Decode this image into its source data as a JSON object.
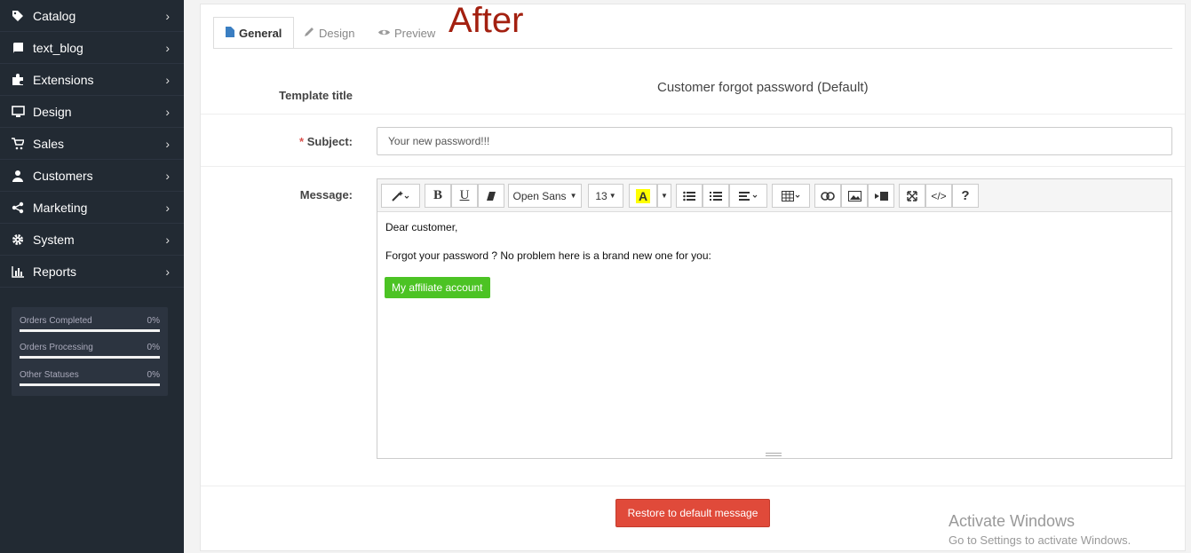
{
  "sidebar": {
    "items": [
      {
        "label": "Catalog",
        "icon": "tags-icon"
      },
      {
        "label": "text_blog",
        "icon": "book-icon"
      },
      {
        "label": "Extensions",
        "icon": "puzzle-icon"
      },
      {
        "label": "Design",
        "icon": "monitor-icon"
      },
      {
        "label": "Sales",
        "icon": "cart-icon"
      },
      {
        "label": "Customers",
        "icon": "user-icon"
      },
      {
        "label": "Marketing",
        "icon": "share-icon"
      },
      {
        "label": "System",
        "icon": "gear-icon"
      },
      {
        "label": "Reports",
        "icon": "bar-chart-icon"
      }
    ],
    "stats": [
      {
        "label": "Orders Completed",
        "value": "0%"
      },
      {
        "label": "Orders Processing",
        "value": "0%"
      },
      {
        "label": "Other Statuses",
        "value": "0%"
      }
    ]
  },
  "tabs": [
    {
      "label": "General",
      "icon": "file-icon",
      "active": true
    },
    {
      "label": "Design",
      "icon": "pencil-icon",
      "active": false
    },
    {
      "label": "Preview",
      "icon": "eye-icon",
      "active": false
    }
  ],
  "annotation": "After",
  "form": {
    "template_title_label": "Template title",
    "template_title_value": "Customer forgot password (Default)",
    "subject_label": "Subject:",
    "subject_required": "*",
    "subject_value": "Your new password!!!",
    "message_label": "Message:"
  },
  "editor": {
    "toolbar": {
      "font": "Open Sans",
      "size": "13"
    },
    "lines": [
      "Dear customer,",
      "Forgot your password ? No problem here is a brand new one for you:"
    ],
    "button_label": "My affiliate account"
  },
  "restore_button": "Restore to default message",
  "watermark": {
    "title": "Activate Windows",
    "subtitle": "Go to Settings to activate Windows."
  },
  "colors": {
    "sidebar_bg": "#222a33",
    "accent_red": "#e04a3a",
    "affiliate_green": "#4cc324",
    "annotation_red": "#a32010"
  }
}
